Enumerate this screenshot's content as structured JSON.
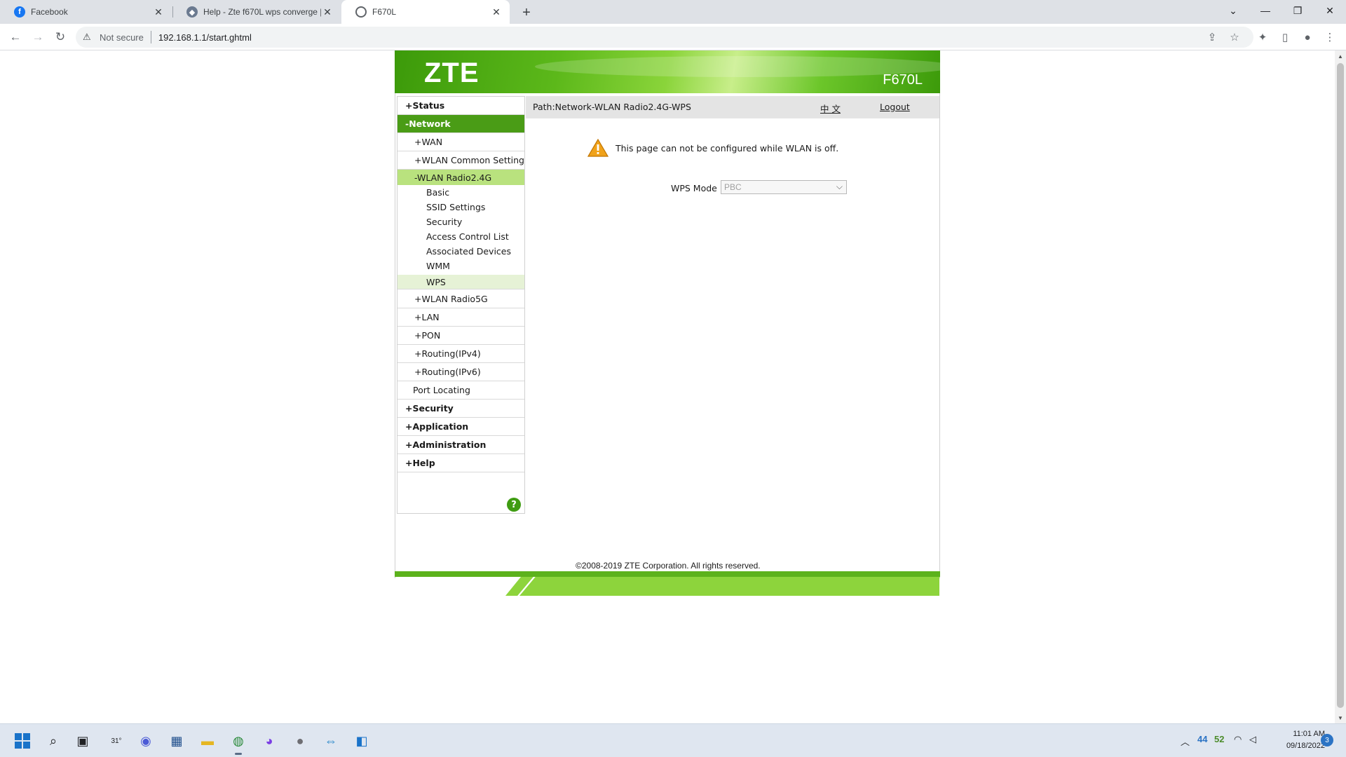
{
  "browser": {
    "tabs": [
      {
        "title": "Facebook",
        "active": false
      },
      {
        "title": "Help - Zte f670L wps converge |",
        "active": false
      },
      {
        "title": "F670L",
        "active": true
      }
    ],
    "new_tab_symbol": "+",
    "security_label": "Not secure",
    "url": "192.168.1.1/start.ghtml"
  },
  "router": {
    "brand": "ZTE",
    "model": "F670L",
    "menu": {
      "status": "+Status",
      "network": "-Network",
      "wan": "+WAN",
      "wlan_common": "+WLAN Common Setting",
      "wlan_24": "-WLAN Radio2.4G",
      "basic": "Basic",
      "ssid_settings": "SSID Settings",
      "security_leaf": "Security",
      "acl": "Access Control List",
      "associated": "Associated Devices",
      "wmm": "WMM",
      "wps": "WPS",
      "wlan_5g": "+WLAN Radio5G",
      "lan": "+LAN",
      "pon": "+PON",
      "routing_v4": "+Routing(IPv4)",
      "routing_v6": "+Routing(IPv6)",
      "port_locating": "Port Locating",
      "security": "+Security",
      "application": "+Application",
      "administration": "+Administration",
      "help": "+Help"
    },
    "help_symbol": "?",
    "path": "Path:Network-WLAN Radio2.4G-WPS",
    "language_link": "中 文",
    "logout": "Logout",
    "warning_message": "This page can not be configured while WLAN is off.",
    "wps_mode_label": "WPS Mode",
    "wps_mode_value": "PBC",
    "copyright": "©2008-2019 ZTE Corporation. All rights reserved."
  },
  "taskbar": {
    "weather_temp": "31°",
    "tray_num_a": "44",
    "tray_num_b": "52",
    "time": "11:01 AM",
    "date": "09/18/2022",
    "notifications": "3"
  },
  "colors": {
    "zte_green": "#5cb21c",
    "menu_selected": "#4a9c16",
    "submenu_selected": "#b9e27e"
  }
}
